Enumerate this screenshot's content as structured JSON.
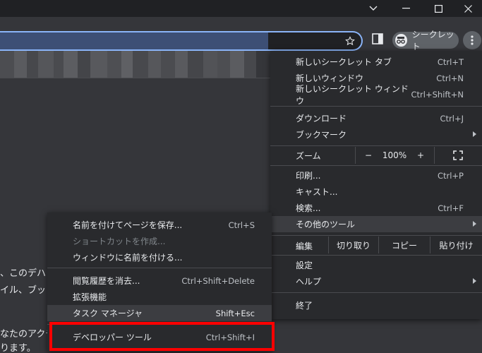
{
  "toolbar": {
    "incognito_label": "シークレット"
  },
  "page_text": {
    "line1": "、このデハ",
    "line2": "イル、ブッ",
    "line3": "なたのアクチ",
    "line4": "ります。"
  },
  "main_menu": {
    "items": [
      {
        "label": "新しいシークレット タブ",
        "shortcut": "Ctrl+T"
      },
      {
        "label": "新しいウィンドウ",
        "shortcut": "Ctrl+N"
      },
      {
        "label": "新しいシークレット ウィンドウ",
        "shortcut": "Ctrl+Shift+N"
      },
      {
        "label": "ダウンロード",
        "shortcut": "Ctrl+J"
      },
      {
        "label": "ブックマーク",
        "shortcut": ""
      },
      {
        "label": "印刷...",
        "shortcut": "Ctrl+P"
      },
      {
        "label": "キャスト...",
        "shortcut": ""
      },
      {
        "label": "検索...",
        "shortcut": "Ctrl+F"
      },
      {
        "label": "その他のツール",
        "shortcut": ""
      },
      {
        "label": "設定",
        "shortcut": ""
      },
      {
        "label": "ヘルプ",
        "shortcut": ""
      },
      {
        "label": "終了",
        "shortcut": ""
      }
    ],
    "zoom": {
      "label": "ズーム",
      "minus": "−",
      "value": "100%",
      "plus": "+"
    },
    "edit": {
      "label": "編集",
      "cut": "切り取り",
      "copy": "コピー",
      "paste": "貼り付け"
    }
  },
  "sub_menu": {
    "items": [
      {
        "label": "名前を付けてページを保存...",
        "shortcut": "Ctrl+S"
      },
      {
        "label": "ショートカットを作成...",
        "shortcut": ""
      },
      {
        "label": "ウィンドウに名前を付ける...",
        "shortcut": ""
      },
      {
        "label": "閲覧履歴を消去...",
        "shortcut": "Ctrl+Shift+Delete"
      },
      {
        "label": "拡張機能",
        "shortcut": ""
      },
      {
        "label": "タスク マネージャ",
        "shortcut": "Shift+Esc"
      },
      {
        "label": "デベロッパー ツール",
        "shortcut": "Ctrl+Shift+I"
      }
    ]
  },
  "colors": {
    "highlight": "#ff0000",
    "accent": "#8ab4f8"
  }
}
